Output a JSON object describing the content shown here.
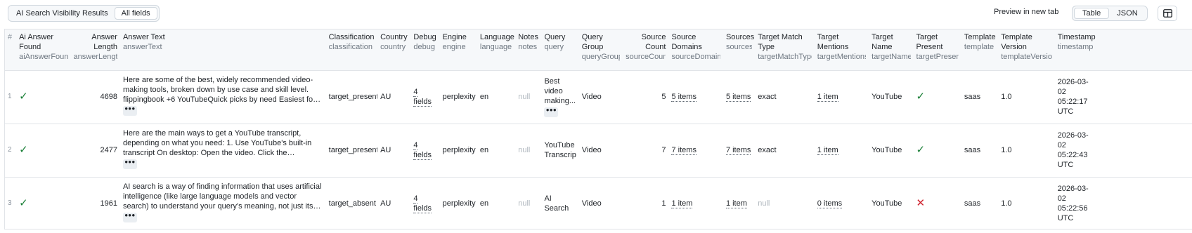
{
  "toolbar": {
    "title_tab": "AI Search Visibility Results",
    "fields_tab": "All fields",
    "preview_link": "Preview in new tab",
    "view_table": "Table",
    "view_json": "JSON"
  },
  "columns": [
    {
      "title": "#",
      "key": ""
    },
    {
      "title": "Ai Answer Found",
      "key": "aiAnswerFound"
    },
    {
      "title": "Answer Length",
      "key": "answerLength"
    },
    {
      "title": "Answer Text",
      "key": "answerText"
    },
    {
      "title": "Classification",
      "key": "classification"
    },
    {
      "title": "Country",
      "key": "country"
    },
    {
      "title": "Debug",
      "key": "debug"
    },
    {
      "title": "Engine",
      "key": "engine"
    },
    {
      "title": "Language",
      "key": "language"
    },
    {
      "title": "Notes",
      "key": "notes"
    },
    {
      "title": "Query",
      "key": "query"
    },
    {
      "title": "Query Group",
      "key": "queryGroup"
    },
    {
      "title": "Source Count",
      "key": "sourceCount"
    },
    {
      "title": "Source Domains",
      "key": "sourceDomains"
    },
    {
      "title": "Sources",
      "key": "sources"
    },
    {
      "title": "Target Match Type",
      "key": "targetMatchType"
    },
    {
      "title": "Target Mentions",
      "key": "targetMentions"
    },
    {
      "title": "Target Name",
      "key": "targetName"
    },
    {
      "title": "Target Present",
      "key": "targetPresent"
    },
    {
      "title": "Template",
      "key": "template"
    },
    {
      "title": "Template Version",
      "key": "templateVersion"
    },
    {
      "title": "Timestamp",
      "key": "timestamp"
    }
  ],
  "rows": [
    {
      "idx": "1",
      "ai_found": "check",
      "answer_length": "4698",
      "answer_text": "Here are some of the best, widely recommended video-making tools, broken down by use case and skill level. flippingbook +6 YouTubeQuick picks by need Easiest for beginners: Clipchamp,...",
      "classification": "target_present",
      "country": "AU",
      "debug": "4 fields",
      "engine": "perplexity",
      "language": "en",
      "notes": "null",
      "query": "Best video making...",
      "query_group": "Video",
      "source_count": "5",
      "source_domains": "5 items",
      "sources": "5 items",
      "match_type": "exact",
      "mentions": "1 item",
      "target_name": "YouTube",
      "target_present": "check",
      "template": "saas",
      "template_version": "1.0",
      "timestamp": "2026-03-02 05:22:17 UTC"
    },
    {
      "idx": "2",
      "ai_found": "check",
      "answer_length": "2477",
      "answer_text": "Here are the main ways to get a YouTube transcript, depending on what you need: 1. Use YouTube's built-in transcript On desktop: Open the video. Click the description (\"...more\" under...",
      "classification": "target_present",
      "country": "AU",
      "debug": "4 fields",
      "engine": "perplexity",
      "language": "en",
      "notes": "null",
      "query": "YouTube Transcript",
      "query_group": "Video",
      "source_count": "7",
      "source_domains": "7 items",
      "sources": "7 items",
      "match_type": "exact",
      "mentions": "1 item",
      "target_name": "YouTube",
      "target_present": "check",
      "template": "saas",
      "template_version": "1.0",
      "timestamp": "2026-03-02 05:22:43 UTC"
    },
    {
      "idx": "3",
      "ai_found": "check",
      "answer_length": "1961",
      "answer_text": "AI search is a way of finding information that uses artificial intelligence (like large language models and vector search) to understand your query's meaning, not just its keywords....",
      "classification": "target_absent",
      "country": "AU",
      "debug": "4 fields",
      "engine": "perplexity",
      "language": "en",
      "notes": "null",
      "query": "AI Search",
      "query_group": "Video",
      "source_count": "1",
      "source_domains": "1 item",
      "sources": "1 item",
      "match_type": "null",
      "mentions": "0 items",
      "target_name": "YouTube",
      "target_present": "cross",
      "template": "saas",
      "template_version": "1.0",
      "timestamp": "2026-03-02 05:22:56 UTC"
    }
  ],
  "icons": {
    "check": "check-icon",
    "cross": "cross-icon",
    "layout": "layout-panel-icon",
    "more": "ellipsis-icon"
  },
  "colors": {
    "check": "#1a7f37",
    "cross": "#cf222e",
    "null": "#b1b8bf"
  }
}
